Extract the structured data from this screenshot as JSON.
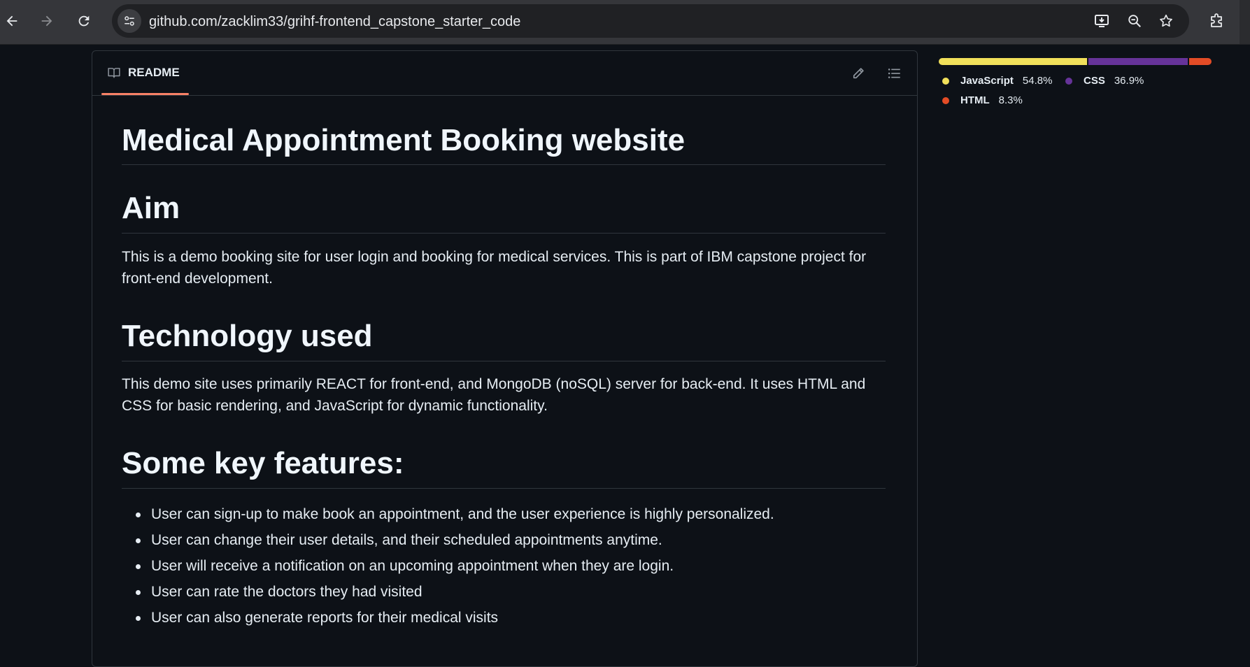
{
  "browser": {
    "url": "github.com/zacklim33/grihf-frontend_capstone_starter_code"
  },
  "readme": {
    "tab_label": "README",
    "title": "Medical Appointment Booking website",
    "sections": [
      {
        "heading": "Aim",
        "text": "This is a demo booking site for user login and booking for medical services. This is part of IBM capstone project for front-end development."
      },
      {
        "heading": "Technology used",
        "text": "This demo site uses primarily REACT for front-end, and MongoDB (noSQL) server for back-end. It uses HTML and CSS for basic rendering, and JavaScript for dynamic functionality."
      },
      {
        "heading": "Some key features:"
      }
    ],
    "features": [
      "User can sign-up to make book an appointment, and the user experience is highly personalized.",
      "User can change their user details, and their scheduled appointments anytime.",
      "User will receive a notification on an upcoming appointment when they are login.",
      "User can rate the doctors they had visited",
      "User can also generate reports for their medical visits"
    ]
  },
  "languages": [
    {
      "name": "JavaScript",
      "percent": "54.8%",
      "value": 54.8,
      "color": "#f1e05a"
    },
    {
      "name": "CSS",
      "percent": "36.9%",
      "value": 36.9,
      "color": "#663399"
    },
    {
      "name": "HTML",
      "percent": "8.3%",
      "value": 8.3,
      "color": "#e34c26"
    }
  ]
}
